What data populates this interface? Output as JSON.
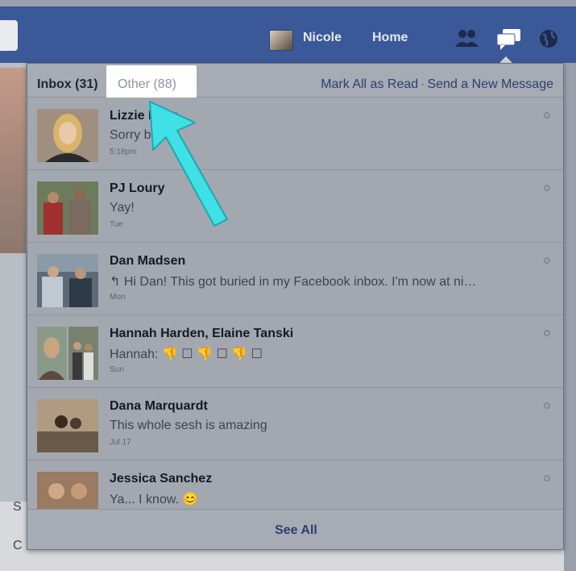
{
  "topbar": {
    "user_name": "Nicole",
    "home_label": "Home",
    "jewels": [
      {
        "icon": "friends-icon"
      },
      {
        "icon": "messages-icon"
      },
      {
        "icon": "globe-icon"
      }
    ]
  },
  "flyout": {
    "tabs": {
      "inbox_label": "Inbox (31)",
      "other_label": "Other (88)"
    },
    "actions": {
      "mark_all_read": "Mark All as Read",
      "separator": "·",
      "send_new_message": "Send a New Message"
    },
    "messages": [
      {
        "name": "Lizzie Fuhr",
        "snippet": "Sorry babe",
        "time": "5:18pm"
      },
      {
        "name": "PJ Loury",
        "snippet": "Yay!",
        "time": "Tue"
      },
      {
        "name": "Dan Madsen",
        "snippet": "↰ Hi Dan! This got buried in my Facebook inbox. I'm now at ni…",
        "time": "Mon"
      },
      {
        "name": "Hannah Harden, Elaine Tanski",
        "snippet": "Hannah: 👎 ☐ 👎 ☐ 👎 ☐",
        "time": "Sun"
      },
      {
        "name": "Dana Marquardt",
        "snippet": "This whole sesh is amazing",
        "time": "Jul 17"
      },
      {
        "name": "Jessica Sanchez",
        "snippet": "Ya... I know. 😊",
        "time": ""
      }
    ],
    "footer": {
      "see_all": "See All"
    }
  },
  "background": {
    "letter_s": "S",
    "letter_c": "C"
  },
  "colors": {
    "brand_blue": "#3b5998",
    "link_blue": "#2b4170",
    "annotation_arrow": "#3fe0e6"
  }
}
